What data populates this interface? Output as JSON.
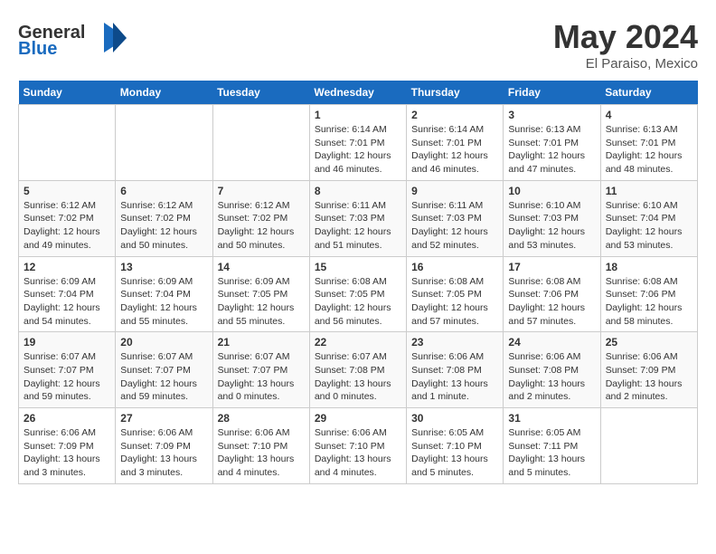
{
  "header": {
    "logo_line1": "General",
    "logo_line2": "Blue",
    "month": "May 2024",
    "location": "El Paraiso, Mexico"
  },
  "weekdays": [
    "Sunday",
    "Monday",
    "Tuesday",
    "Wednesday",
    "Thursday",
    "Friday",
    "Saturday"
  ],
  "weeks": [
    [
      {
        "day": "",
        "content": ""
      },
      {
        "day": "",
        "content": ""
      },
      {
        "day": "",
        "content": ""
      },
      {
        "day": "1",
        "content": "Sunrise: 6:14 AM\nSunset: 7:01 PM\nDaylight: 12 hours\nand 46 minutes."
      },
      {
        "day": "2",
        "content": "Sunrise: 6:14 AM\nSunset: 7:01 PM\nDaylight: 12 hours\nand 46 minutes."
      },
      {
        "day": "3",
        "content": "Sunrise: 6:13 AM\nSunset: 7:01 PM\nDaylight: 12 hours\nand 47 minutes."
      },
      {
        "day": "4",
        "content": "Sunrise: 6:13 AM\nSunset: 7:01 PM\nDaylight: 12 hours\nand 48 minutes."
      }
    ],
    [
      {
        "day": "5",
        "content": "Sunrise: 6:12 AM\nSunset: 7:02 PM\nDaylight: 12 hours\nand 49 minutes."
      },
      {
        "day": "6",
        "content": "Sunrise: 6:12 AM\nSunset: 7:02 PM\nDaylight: 12 hours\nand 50 minutes."
      },
      {
        "day": "7",
        "content": "Sunrise: 6:12 AM\nSunset: 7:02 PM\nDaylight: 12 hours\nand 50 minutes."
      },
      {
        "day": "8",
        "content": "Sunrise: 6:11 AM\nSunset: 7:03 PM\nDaylight: 12 hours\nand 51 minutes."
      },
      {
        "day": "9",
        "content": "Sunrise: 6:11 AM\nSunset: 7:03 PM\nDaylight: 12 hours\nand 52 minutes."
      },
      {
        "day": "10",
        "content": "Sunrise: 6:10 AM\nSunset: 7:03 PM\nDaylight: 12 hours\nand 53 minutes."
      },
      {
        "day": "11",
        "content": "Sunrise: 6:10 AM\nSunset: 7:04 PM\nDaylight: 12 hours\nand 53 minutes."
      }
    ],
    [
      {
        "day": "12",
        "content": "Sunrise: 6:09 AM\nSunset: 7:04 PM\nDaylight: 12 hours\nand 54 minutes."
      },
      {
        "day": "13",
        "content": "Sunrise: 6:09 AM\nSunset: 7:04 PM\nDaylight: 12 hours\nand 55 minutes."
      },
      {
        "day": "14",
        "content": "Sunrise: 6:09 AM\nSunset: 7:05 PM\nDaylight: 12 hours\nand 55 minutes."
      },
      {
        "day": "15",
        "content": "Sunrise: 6:08 AM\nSunset: 7:05 PM\nDaylight: 12 hours\nand 56 minutes."
      },
      {
        "day": "16",
        "content": "Sunrise: 6:08 AM\nSunset: 7:05 PM\nDaylight: 12 hours\nand 57 minutes."
      },
      {
        "day": "17",
        "content": "Sunrise: 6:08 AM\nSunset: 7:06 PM\nDaylight: 12 hours\nand 57 minutes."
      },
      {
        "day": "18",
        "content": "Sunrise: 6:08 AM\nSunset: 7:06 PM\nDaylight: 12 hours\nand 58 minutes."
      }
    ],
    [
      {
        "day": "19",
        "content": "Sunrise: 6:07 AM\nSunset: 7:07 PM\nDaylight: 12 hours\nand 59 minutes."
      },
      {
        "day": "20",
        "content": "Sunrise: 6:07 AM\nSunset: 7:07 PM\nDaylight: 12 hours\nand 59 minutes."
      },
      {
        "day": "21",
        "content": "Sunrise: 6:07 AM\nSunset: 7:07 PM\nDaylight: 13 hours\nand 0 minutes."
      },
      {
        "day": "22",
        "content": "Sunrise: 6:07 AM\nSunset: 7:08 PM\nDaylight: 13 hours\nand 0 minutes."
      },
      {
        "day": "23",
        "content": "Sunrise: 6:06 AM\nSunset: 7:08 PM\nDaylight: 13 hours\nand 1 minute."
      },
      {
        "day": "24",
        "content": "Sunrise: 6:06 AM\nSunset: 7:08 PM\nDaylight: 13 hours\nand 2 minutes."
      },
      {
        "day": "25",
        "content": "Sunrise: 6:06 AM\nSunset: 7:09 PM\nDaylight: 13 hours\nand 2 minutes."
      }
    ],
    [
      {
        "day": "26",
        "content": "Sunrise: 6:06 AM\nSunset: 7:09 PM\nDaylight: 13 hours\nand 3 minutes."
      },
      {
        "day": "27",
        "content": "Sunrise: 6:06 AM\nSunset: 7:09 PM\nDaylight: 13 hours\nand 3 minutes."
      },
      {
        "day": "28",
        "content": "Sunrise: 6:06 AM\nSunset: 7:10 PM\nDaylight: 13 hours\nand 4 minutes."
      },
      {
        "day": "29",
        "content": "Sunrise: 6:06 AM\nSunset: 7:10 PM\nDaylight: 13 hours\nand 4 minutes."
      },
      {
        "day": "30",
        "content": "Sunrise: 6:05 AM\nSunset: 7:10 PM\nDaylight: 13 hours\nand 5 minutes."
      },
      {
        "day": "31",
        "content": "Sunrise: 6:05 AM\nSunset: 7:11 PM\nDaylight: 13 hours\nand 5 minutes."
      },
      {
        "day": "",
        "content": ""
      }
    ]
  ]
}
